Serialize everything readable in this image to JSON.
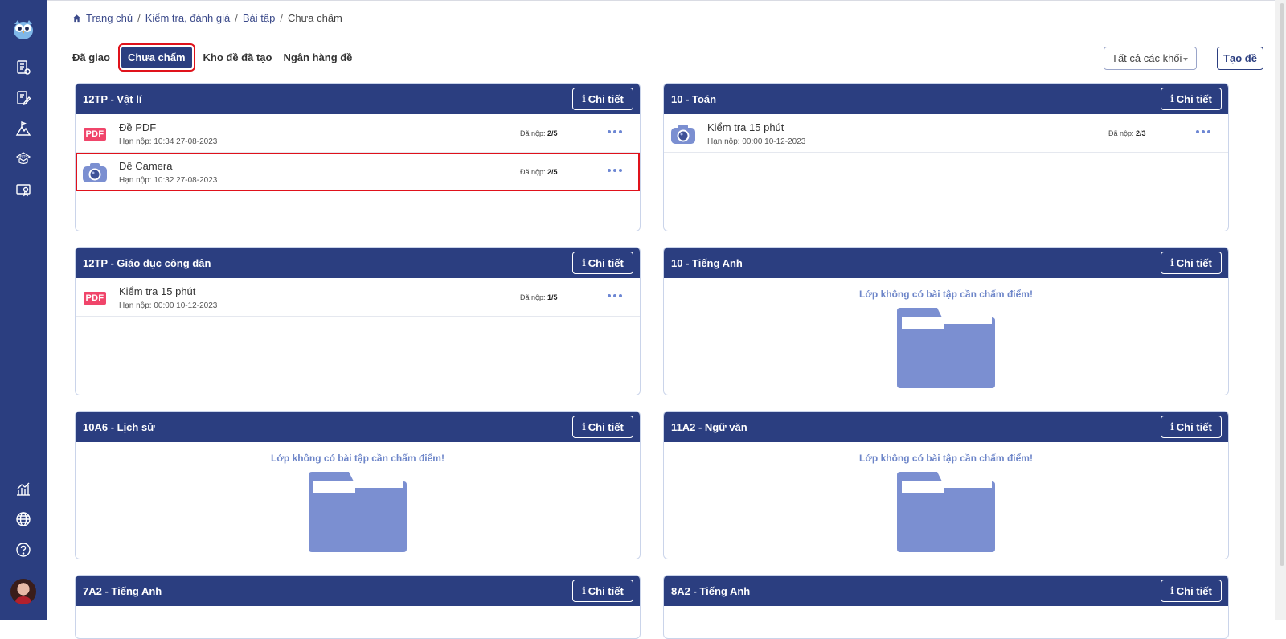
{
  "breadcrumb": [
    "Trang chủ",
    "Kiểm tra, đánh giá",
    "Bài tập",
    "Chưa chấm"
  ],
  "tabs": [
    {
      "label": "Đã giao",
      "active": false
    },
    {
      "label": "Chưa chấm",
      "active": true
    },
    {
      "label": "Kho đề đã tạo",
      "active": false
    },
    {
      "label": "Ngân hàng đề",
      "active": false
    }
  ],
  "filter": {
    "selected": "Tất cả các khối"
  },
  "actions": {
    "create_label": "Tạo đề"
  },
  "detail_label": "Chi tiết",
  "empty_message": "Lớp không có bài tập cần chấm điểm!",
  "colors": {
    "primary": "#2b3e80",
    "highlight": "#e0121b",
    "pdf": "#f0456a",
    "empty_text": "#6e86c9",
    "folder": "#7b8fd1"
  },
  "cards": [
    {
      "title": "12TP - Vật lí",
      "assignments": [
        {
          "icon": "pdf-icon",
          "type_label": "PDF",
          "title": "Đề PDF",
          "due": "Hạn nộp: 10:34 27-08-2023",
          "submitted_label": "Đã nộp:",
          "submitted": "2/5"
        },
        {
          "icon": "camera-icon",
          "title": "Đề Camera",
          "due": "Hạn nộp: 10:32 27-08-2023",
          "submitted_label": "Đã nộp:",
          "submitted": "2/5"
        }
      ]
    },
    {
      "title": "10 - Toán",
      "assignments": [
        {
          "icon": "camera-icon",
          "title": "Kiểm tra 15 phút",
          "due": "Hạn nộp: 00:00 10-12-2023",
          "submitted_label": "Đã nộp:",
          "submitted": "2/3"
        }
      ]
    },
    {
      "title": "12TP - Giáo dục công dân",
      "assignments": [
        {
          "icon": "pdf-icon",
          "type_label": "PDF",
          "title": "Kiểm tra 15 phút",
          "due": "Hạn nộp: 00:00 10-12-2023",
          "submitted_label": "Đã nộp:",
          "submitted": "1/5"
        }
      ]
    },
    {
      "title": "10 - Tiếng Anh",
      "assignments": []
    },
    {
      "title": "10A6 - Lịch sử",
      "assignments": []
    },
    {
      "title": "11A2 - Ngữ văn",
      "assignments": []
    },
    {
      "title": "7A2 - Tiếng Anh",
      "assignments": []
    },
    {
      "title": "8A2 - Tiếng Anh",
      "assignments": []
    }
  ]
}
